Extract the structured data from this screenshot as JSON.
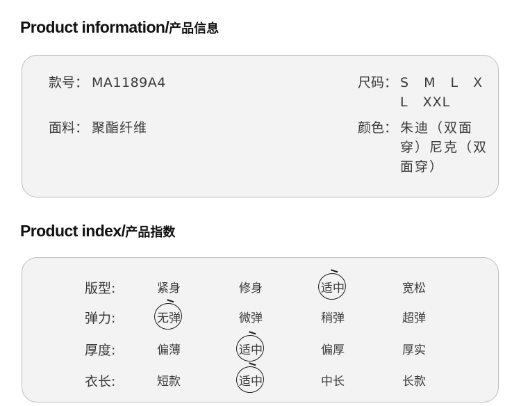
{
  "product_information": {
    "title_en": "Product information/",
    "title_cn": "产品信息",
    "style_label": "款号：",
    "style_value": "MA1189A4",
    "size_label": "尺码：",
    "size_value": "S M L X L XXL",
    "fabric_label": "面料：",
    "fabric_value": "聚酯纤维",
    "color_label": "颜色：",
    "color_value": "朱迪（双面穿）尼克（双面穿）"
  },
  "product_index": {
    "title_en": "Product index/",
    "title_cn": "产品指数",
    "rows": [
      {
        "label": "版型:",
        "options": [
          "紧身",
          "修身",
          "适中",
          "宽松"
        ],
        "selected_option": "适中"
      },
      {
        "label": "弹力:",
        "options": [
          "无弹",
          "微弹",
          "稍弹",
          "超弹"
        ],
        "selected_option": "无弹"
      },
      {
        "label": "厚度:",
        "options": [
          "偏薄",
          "适中",
          "偏厚",
          "厚实"
        ],
        "selected_option": "适中"
      },
      {
        "label": "衣长:",
        "options": [
          "短款",
          "适中",
          "中长",
          "长款"
        ],
        "selected_option": "适中"
      }
    ]
  }
}
